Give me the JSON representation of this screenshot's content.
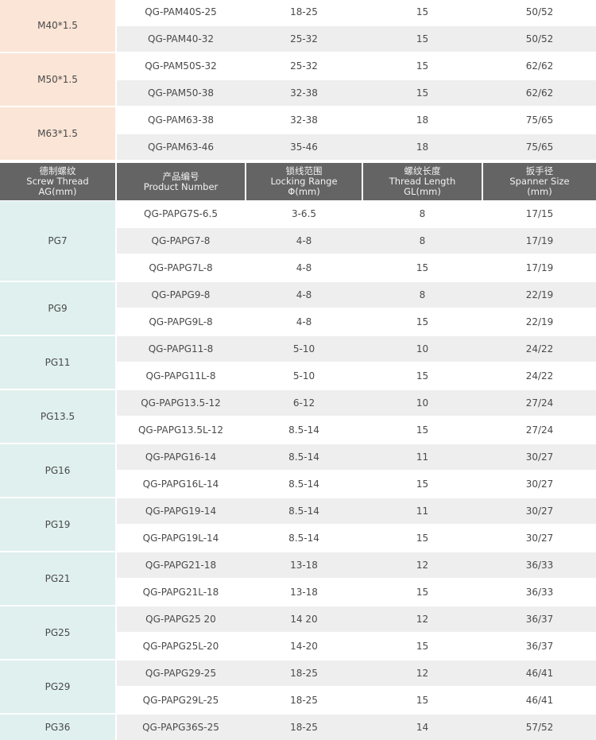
{
  "top_groups": [
    {
      "thread": "M40*1.5",
      "rows": [
        {
          "product": "QG-PAM40S-25",
          "range": "18-25",
          "length": "15",
          "spanner": "50/52"
        },
        {
          "product": "QG-PAM40-32",
          "range": "25-32",
          "length": "15",
          "spanner": "50/52"
        }
      ]
    },
    {
      "thread": "M50*1.5",
      "rows": [
        {
          "product": "QG-PAM50S-32",
          "range": "25-32",
          "length": "15",
          "spanner": "62/62"
        },
        {
          "product": "QG-PAM50-38",
          "range": "32-38",
          "length": "15",
          "spanner": "62/62"
        }
      ]
    },
    {
      "thread": "M63*1.5",
      "rows": [
        {
          "product": "QG-PAM63-38",
          "range": "32-38",
          "length": "18",
          "spanner": "75/65"
        },
        {
          "product": "QG-PAM63-46",
          "range": "35-46",
          "length": "18",
          "spanner": "75/65"
        }
      ]
    }
  ],
  "header": {
    "thread": {
      "cn": "德制螺纹",
      "en1": "Screw Thread",
      "en2": "AG(mm)"
    },
    "product": {
      "cn": "产品编号",
      "en1": "Product Number",
      "en2": ""
    },
    "range": {
      "cn": "锁线范围",
      "en1": "Locking Range",
      "en2": "Φ(mm)"
    },
    "length": {
      "cn": "螺纹长度",
      "en1": "Thread Length",
      "en2": "GL(mm)"
    },
    "spanner": {
      "cn": "扳手径",
      "en1": "Spanner Size",
      "en2": "(mm)"
    }
  },
  "pg_groups": [
    {
      "thread": "PG7",
      "rows": [
        {
          "product": "QG-PAPG7S-6.5",
          "range": "3-6.5",
          "length": "8",
          "spanner": "17/15"
        },
        {
          "product": "QG-PAPG7-8",
          "range": "4-8",
          "length": "8",
          "spanner": "17/19"
        },
        {
          "product": "QG-PAPG7L-8",
          "range": "4-8",
          "length": "15",
          "spanner": "17/19"
        }
      ]
    },
    {
      "thread": "PG9",
      "rows": [
        {
          "product": "QG-PAPG9-8",
          "range": "4-8",
          "length": "8",
          "spanner": "22/19"
        },
        {
          "product": "QG-PAPG9L-8",
          "range": "4-8",
          "length": "15",
          "spanner": "22/19"
        }
      ]
    },
    {
      "thread": "PG11",
      "rows": [
        {
          "product": "QG-PAPG11-8",
          "range": "5-10",
          "length": "10",
          "spanner": "24/22"
        },
        {
          "product": "QG-PAPG11L-8",
          "range": "5-10",
          "length": "15",
          "spanner": "24/22"
        }
      ]
    },
    {
      "thread": "PG13.5",
      "rows": [
        {
          "product": "QG-PAPG13.5-12",
          "range": "6-12",
          "length": "10",
          "spanner": "27/24"
        },
        {
          "product": "QG-PAPG13.5L-12",
          "range": "8.5-14",
          "length": "15",
          "spanner": "27/24"
        }
      ]
    },
    {
      "thread": "PG16",
      "rows": [
        {
          "product": "QG-PAPG16-14",
          "range": "8.5-14",
          "length": "11",
          "spanner": "30/27"
        },
        {
          "product": "QG-PAPG16L-14",
          "range": "8.5-14",
          "length": "15",
          "spanner": "30/27"
        }
      ]
    },
    {
      "thread": "PG19",
      "rows": [
        {
          "product": "QG-PAPG19-14",
          "range": "8.5-14",
          "length": "11",
          "spanner": "30/27"
        },
        {
          "product": "QG-PAPG19L-14",
          "range": "8.5-14",
          "length": "15",
          "spanner": "30/27"
        }
      ]
    },
    {
      "thread": "PG21",
      "rows": [
        {
          "product": "QG-PAPG21-18",
          "range": "13-18",
          "length": "12",
          "spanner": "36/33"
        },
        {
          "product": "QG-PAPG21L-18",
          "range": "13-18",
          "length": "15",
          "spanner": "36/33"
        }
      ]
    },
    {
      "thread": "PG25",
      "rows": [
        {
          "product": "QG-PAPG25 20",
          "range": "14 20",
          "length": "12",
          "spanner": "36/37"
        },
        {
          "product": "QG-PAPG25L-20",
          "range": "14-20",
          "length": "15",
          "spanner": "36/37"
        }
      ]
    },
    {
      "thread": "PG29",
      "rows": [
        {
          "product": "QG-PAPG29-25",
          "range": "18-25",
          "length": "12",
          "spanner": "46/41"
        },
        {
          "product": "QG-PAPG29L-25",
          "range": "18-25",
          "length": "15",
          "spanner": "46/41"
        }
      ]
    },
    {
      "thread": "PG36",
      "rows": [
        {
          "product": "QG-PAPG36S-25",
          "range": "18-25",
          "length": "14",
          "spanner": "57/52"
        }
      ]
    }
  ]
}
